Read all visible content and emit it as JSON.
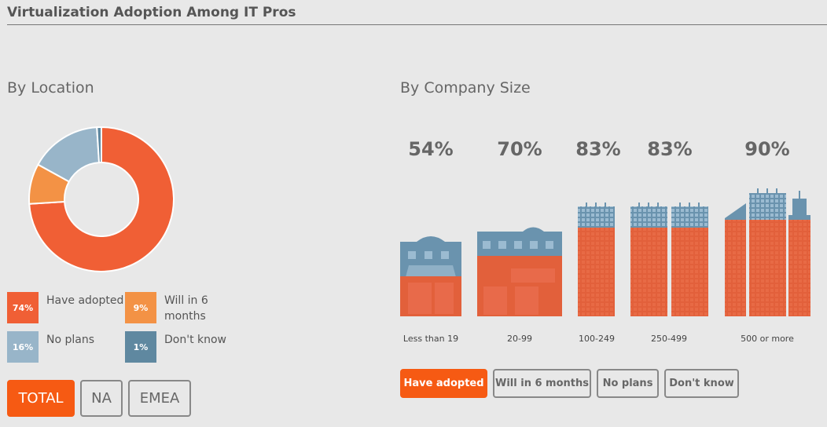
{
  "title": "Virtualization Adoption Among IT Pros",
  "colors": {
    "have_adopted": "#f05f35",
    "will_in_6_months": "#f39245",
    "no_plans": "#98b5c9",
    "dont_know": "#5f88a0",
    "active_button": "#f65a13",
    "building_top": "#6a93ae"
  },
  "chart_data": [
    {
      "type": "pie",
      "title": "By Location",
      "donut": true,
      "slices": [
        {
          "label": "Have adopted",
          "value": 74,
          "display": "74%"
        },
        {
          "label": "Will in 6 months",
          "value": 9,
          "display": "9%"
        },
        {
          "label": "No plans",
          "value": 16,
          "display": "16%"
        },
        {
          "label": "Don't know",
          "value": 1,
          "display": "1%"
        }
      ],
      "filters": [
        {
          "label": "TOTAL",
          "active": true
        },
        {
          "label": "NA",
          "active": false
        },
        {
          "label": "EMEA",
          "active": false
        }
      ]
    },
    {
      "type": "bar",
      "title": "By Company Size",
      "style": "building pictogram",
      "categories": [
        "Less than 19",
        "20-99",
        "100-249",
        "250-499",
        "500 or more"
      ],
      "values": [
        54,
        70,
        83,
        83,
        90
      ],
      "display": [
        "54%",
        "70%",
        "83%",
        "83%",
        "90%"
      ],
      "filters": [
        {
          "label": "Have adopted",
          "active": true
        },
        {
          "label": "Will in 6 months",
          "active": false
        },
        {
          "label": "No plans",
          "active": false
        },
        {
          "label": "Don't know",
          "active": false
        }
      ]
    }
  ]
}
